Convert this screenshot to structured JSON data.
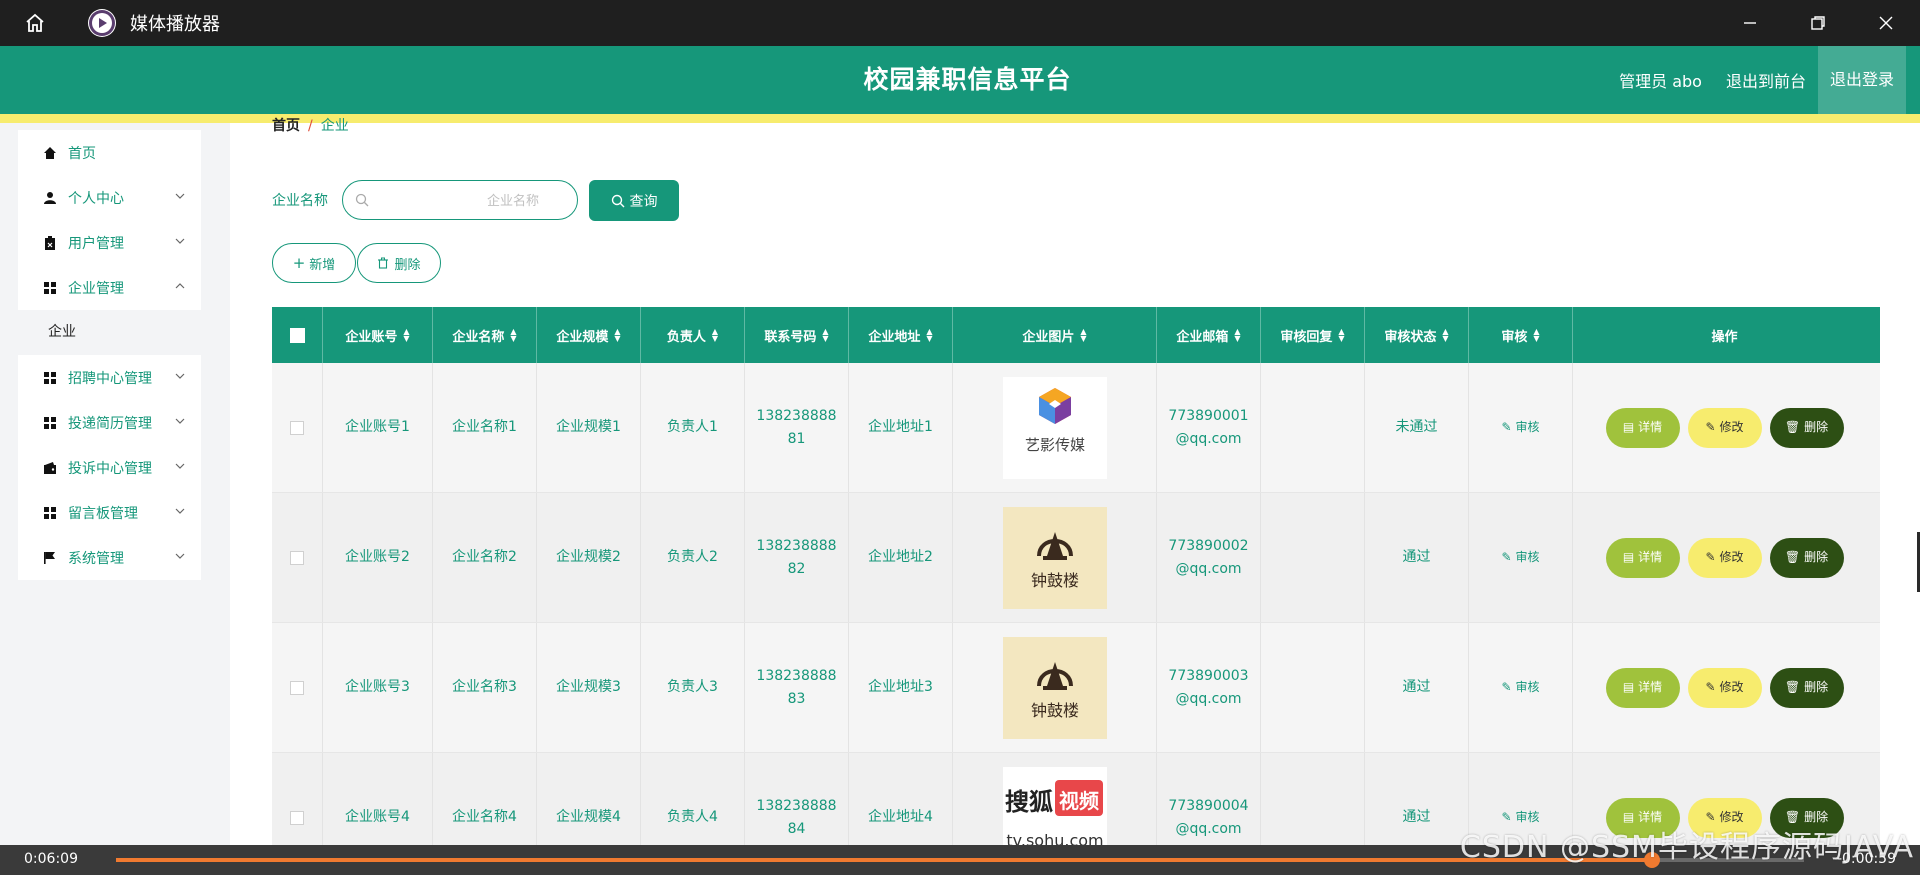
{
  "window": {
    "title": "媒体播放器"
  },
  "header": {
    "title": "校园兼职信息平台",
    "admin": "管理员 abo",
    "exit_front": "退出到前台",
    "logout": "退出登录"
  },
  "sidebar": {
    "items": [
      {
        "label": "首页",
        "icon": "home-icon"
      },
      {
        "label": "个人中心",
        "icon": "user-icon"
      },
      {
        "label": "用户管理",
        "icon": "clipboard-icon"
      },
      {
        "label": "企业管理",
        "icon": "grid-icon"
      },
      {
        "label": "企业",
        "icon": ""
      },
      {
        "label": "招聘中心管理",
        "icon": "grid-icon"
      },
      {
        "label": "投递简历管理",
        "icon": "grid-icon"
      },
      {
        "label": "投诉中心管理",
        "icon": "wallet-icon"
      },
      {
        "label": "留言板管理",
        "icon": "grid-icon"
      },
      {
        "label": "系统管理",
        "icon": "flag-icon"
      }
    ]
  },
  "breadcrumb": {
    "home": "首页",
    "sep": "/",
    "current": "企业"
  },
  "search": {
    "label": "企业名称",
    "placeholder": "企业名称",
    "query_label": "查询"
  },
  "actions": {
    "add_label": "新增",
    "delete_label": "删除"
  },
  "table": {
    "columns": [
      "企业账号",
      "企业名称",
      "企业规模",
      "负责人",
      "联系号码",
      "企业地址",
      "企业图片",
      "企业邮箱",
      "审核回复",
      "审核状态",
      "审核",
      "操作"
    ],
    "rows": [
      {
        "account": "企业账号1",
        "name": "企业名称1",
        "scale": "企业规模1",
        "person": "负责人1",
        "phone_a": "138238888",
        "phone_b": "81",
        "address": "企业地址1",
        "image": "艺影传媒",
        "email_a": "773890001",
        "email_b": "@qq.com",
        "reply": "",
        "status": "未通过",
        "audit": "审核"
      },
      {
        "account": "企业账号2",
        "name": "企业名称2",
        "scale": "企业规模2",
        "person": "负责人2",
        "phone_a": "138238888",
        "phone_b": "82",
        "address": "企业地址2",
        "image": "钟鼓楼",
        "email_a": "773890002",
        "email_b": "@qq.com",
        "reply": "",
        "status": "通过",
        "audit": "审核"
      },
      {
        "account": "企业账号3",
        "name": "企业名称3",
        "scale": "企业规模3",
        "person": "负责人3",
        "phone_a": "138238888",
        "phone_b": "83",
        "address": "企业地址3",
        "image": "钟鼓楼",
        "email_a": "773890003",
        "email_b": "@qq.com",
        "reply": "",
        "status": "通过",
        "audit": "审核"
      },
      {
        "account": "企业账号4",
        "name": "企业名称4",
        "scale": "企业规模4",
        "person": "负责人4",
        "phone_a": "138238888",
        "phone_b": "84",
        "address": "企业地址4",
        "image": "搜狐视频 tv.sohu.com",
        "email_a": "773890004",
        "email_b": "@qq.com",
        "reply": "",
        "status": "通过",
        "audit": "审核"
      }
    ],
    "op_labels": {
      "detail": "详情",
      "edit": "修改",
      "delete": "删除"
    }
  },
  "player": {
    "elapsed": "0:06:09",
    "remaining": "-0:00:59",
    "progress": 0.91
  },
  "watermark": "CSDN @SSM毕设程序源码JAVA",
  "colors": {
    "primary": "#16977a",
    "accent_yellow": "#f7ec6e",
    "detail_green": "#a0c23c",
    "delete_dark": "#2d4f14",
    "progress": "#f07a30"
  }
}
